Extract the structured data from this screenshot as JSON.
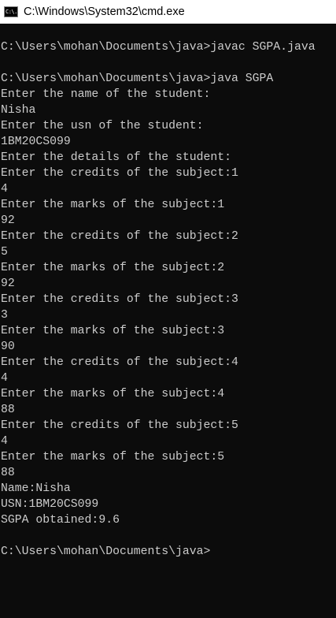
{
  "window": {
    "title": "C:\\Windows\\System32\\cmd.exe",
    "icon": "cmd-icon",
    "icon_label": "C:\\."
  },
  "console": {
    "lines": [
      "C:\\Users\\mohan\\Documents\\java>javac SGPA.java",
      "",
      "C:\\Users\\mohan\\Documents\\java>java SGPA",
      "Enter the name of the student:",
      "Nisha",
      "Enter the usn of the student:",
      "1BM20CS099",
      "Enter the details of the student:",
      "Enter the credits of the subject:1",
      "4",
      "Enter the marks of the subject:1",
      "92",
      "Enter the credits of the subject:2",
      "5",
      "Enter the marks of the subject:2",
      "92",
      "Enter the credits of the subject:3",
      "3",
      "Enter the marks of the subject:3",
      "90",
      "Enter the credits of the subject:4",
      "4",
      "Enter the marks of the subject:4",
      "88",
      "Enter the credits of the subject:5",
      "4",
      "Enter the marks of the subject:5",
      "88",
      "Name:Nisha",
      "USN:1BM20CS099",
      "SGPA obtained:9.6",
      "",
      "C:\\Users\\mohan\\Documents\\java>"
    ]
  },
  "colors": {
    "background": "#0c0c0c",
    "text": "#cccccc",
    "titlebar": "#ffffff"
  }
}
